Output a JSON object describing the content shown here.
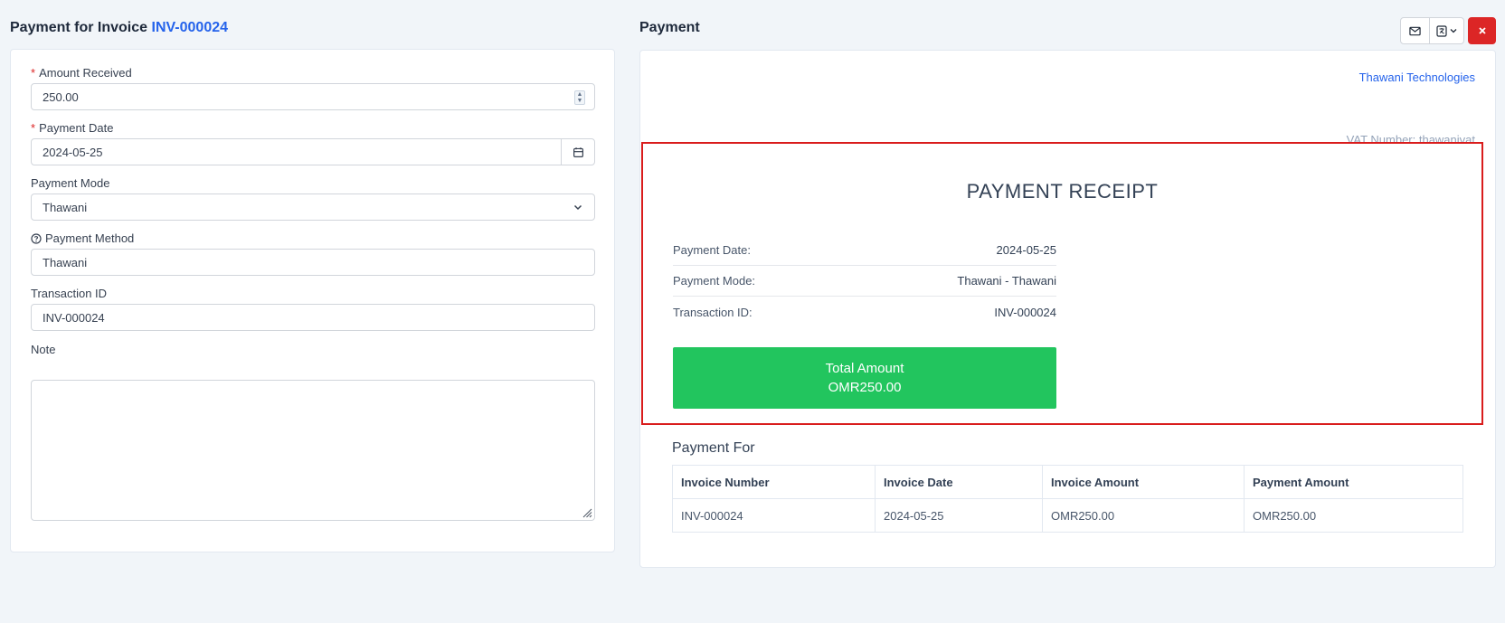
{
  "left": {
    "title_prefix": "Payment for Invoice",
    "invoice_number": "INV-000024",
    "fields": {
      "amount_label": "Amount Received",
      "amount_value": "250.00",
      "date_label": "Payment Date",
      "date_value": "2024-05-25",
      "mode_label": "Payment Mode",
      "mode_value": "Thawani",
      "method_label": "Payment Method",
      "method_value": "Thawani",
      "txn_label": "Transaction ID",
      "txn_value": "INV-000024",
      "note_label": "Note",
      "required_mark": "*"
    }
  },
  "right": {
    "title": "Payment",
    "company": "Thawani Technologies",
    "vat": "VAT Number: thawanivat"
  },
  "receipt": {
    "title": "PAYMENT RECEIPT",
    "rows": [
      {
        "label": "Payment Date:",
        "value": "2024-05-25"
      },
      {
        "label": "Payment Mode:",
        "value": "Thawani - Thawani"
      },
      {
        "label": "Transaction ID:",
        "value": "INV-000024"
      }
    ],
    "total_label": "Total Amount",
    "total_value": "OMR250.00"
  },
  "payment_for": {
    "title": "Payment For",
    "headers": [
      "Invoice Number",
      "Invoice Date",
      "Invoice Amount",
      "Payment Amount"
    ],
    "rows": [
      [
        "INV-000024",
        "2024-05-25",
        "OMR250.00",
        "OMR250.00"
      ]
    ]
  },
  "icons": {
    "mail": "mail-icon",
    "language": "language-icon",
    "close": "close-icon",
    "calendar": "calendar-icon",
    "chevron": "chevron-down-icon",
    "help": "help-circle-icon"
  },
  "colors": {
    "accent": "#2563eb",
    "danger": "#dc2626",
    "success": "#22c55e"
  }
}
